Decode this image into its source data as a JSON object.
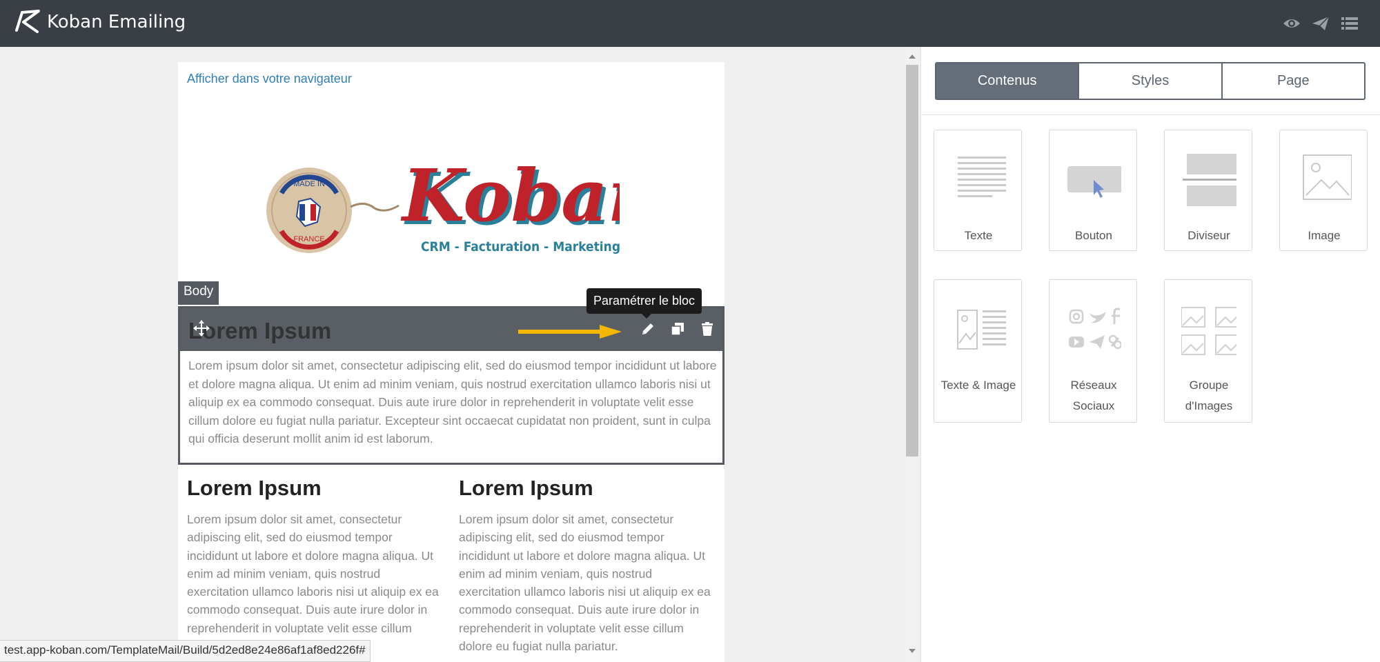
{
  "app": {
    "title": "Koban Emailing"
  },
  "toolbar": {
    "icons": [
      "eye-icon",
      "send-icon",
      "menu-icon"
    ]
  },
  "email": {
    "browser_link": "Afficher dans votre navigateur",
    "logo": {
      "badge_top": "MADE IN",
      "badge_bottom": "FRANCE",
      "brand": "Koban",
      "tagline": "CRM - Facturation - Marketing"
    },
    "body_tag": "Body",
    "tooltip": "Paramétrer le bloc",
    "selected_block": {
      "title": "Lorem Ipsum",
      "text": "Lorem ipsum dolor sit amet, consectetur adipiscing elit, sed do eiusmod tempor incididunt ut labore et dolore magna aliqua. Ut enim ad minim veniam, quis nostrud exercitation ullamco laboris nisi ut aliquip ex ea commodo consequat. Duis aute irure dolor in reprehenderit in voluptate velit esse cillum dolore eu fugiat nulla pariatur. Excepteur sint occaecat cupidatat non proident, sunt in culpa qui officia deserunt mollit anim id est laborum."
    },
    "columns": [
      {
        "title": "Lorem Ipsum",
        "text": "Lorem ipsum dolor sit amet, consectetur adipiscing elit, sed do eiusmod tempor incididunt ut labore et dolore magna aliqua. Ut enim ad minim veniam, quis nostrud exercitation ullamco laboris nisi ut aliquip ex ea commodo consequat. Duis aute irure dolor in reprehenderit in voluptate velit esse cillum dolore eu fugiat nulla pariatur."
      },
      {
        "title": "Lorem Ipsum",
        "text": "Lorem ipsum dolor sit amet, consectetur adipiscing elit, sed do eiusmod tempor incididunt ut labore et dolore magna aliqua. Ut enim ad minim veniam, quis nostrud exercitation ullamco laboris nisi ut aliquip ex ea commodo consequat. Duis aute irure dolor in reprehenderit in voluptate velit esse cillum dolore eu fugiat nulla pariatur."
      }
    ]
  },
  "panel": {
    "tabs": [
      {
        "label": "Contenus",
        "active": true
      },
      {
        "label": "Styles",
        "active": false
      },
      {
        "label": "Page",
        "active": false
      }
    ],
    "tiles": [
      {
        "label": "Texte"
      },
      {
        "label": "Bouton"
      },
      {
        "label": "Diviseur"
      },
      {
        "label": "Image"
      },
      {
        "label": "Texte & Image"
      },
      {
        "label": "Réseaux Sociaux"
      },
      {
        "label": "Groupe d'Images"
      }
    ]
  },
  "status_url": "test.app-koban.com/TemplateMail/Build/5d2ed8e24e86af1af8ed226f#",
  "colors": {
    "topbar": "#3a3f45",
    "accent_arrow": "#f5b800",
    "link": "#2f7fb8",
    "brand_red": "#c0222a",
    "brand_teal": "#2a7f9a"
  }
}
